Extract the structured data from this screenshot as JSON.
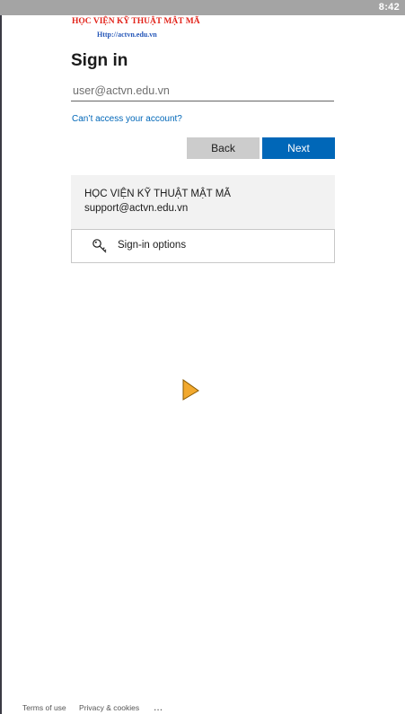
{
  "status_bar": {
    "time": "8:42"
  },
  "banner": {
    "title": "HỌC VIỆN KỸ THUẬT MẬT MÃ",
    "url": "Http://actvn.edu.vn"
  },
  "signin": {
    "title": "Sign in",
    "email_placeholder": "user@actvn.edu.vn",
    "cant_access_link": "Can’t access your account?",
    "back_label": "Back",
    "next_label": "Next"
  },
  "org_panel": {
    "name": "HỌC VIỆN KỸ THUẬT MẬT MÃ",
    "email": "support@actvn.edu.vn"
  },
  "signin_options": {
    "label": "Sign-in options",
    "icon": "key-icon"
  },
  "footer": {
    "terms": "Terms of use",
    "privacy": "Privacy & cookies",
    "more": "..."
  },
  "colors": {
    "accent": "#0067b8",
    "back_button": "#cccccc",
    "panel_bg": "#f2f2f2",
    "banner_red": "#e2241b",
    "banner_blue": "#2456b8",
    "cursor": "#f2a92e"
  }
}
